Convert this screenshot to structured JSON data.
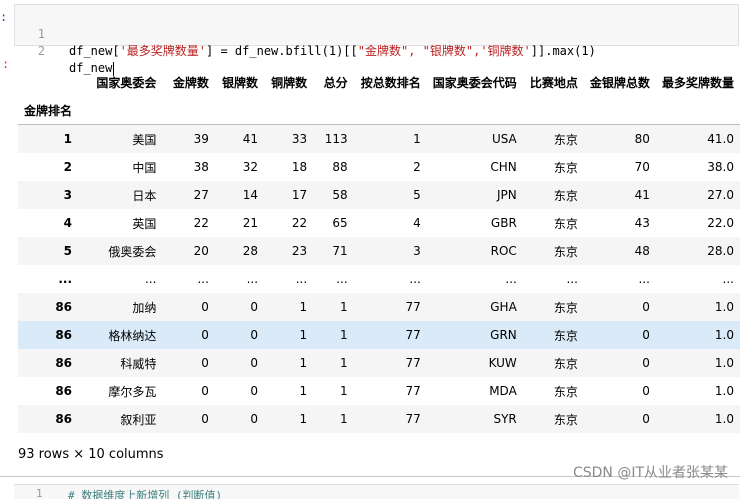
{
  "code_cell": {
    "prompt": ":",
    "line1": {
      "num": "1",
      "p1": "df_new[",
      "s1": "'最多奖牌数量'",
      "p2": "] = df_new.bfill(1)[[",
      "s2": "\"金牌数\", \"银牌数\",'铜牌数'",
      "p3": "]].max(1)"
    },
    "line2": {
      "num": "2",
      "text": "df_new"
    }
  },
  "output_prompt": ":",
  "dataframe": {
    "columns": [
      "国家奥委会",
      "金牌数",
      "银牌数",
      "铜牌数",
      "总分",
      "按总数排名",
      "国家奥委会代码",
      "比赛地点",
      "金银牌总数",
      "最多奖牌数量"
    ],
    "index_name": "金牌排名",
    "rows": [
      {
        "index": "1",
        "cells": [
          "美国",
          "39",
          "41",
          "33",
          "113",
          "1",
          "USA",
          "东京",
          "80",
          "41.0"
        ]
      },
      {
        "index": "2",
        "cells": [
          "中国",
          "38",
          "32",
          "18",
          "88",
          "2",
          "CHN",
          "东京",
          "70",
          "38.0"
        ]
      },
      {
        "index": "3",
        "cells": [
          "日本",
          "27",
          "14",
          "17",
          "58",
          "5",
          "JPN",
          "东京",
          "41",
          "27.0"
        ]
      },
      {
        "index": "4",
        "cells": [
          "英国",
          "22",
          "21",
          "22",
          "65",
          "4",
          "GBR",
          "东京",
          "43",
          "22.0"
        ]
      },
      {
        "index": "5",
        "cells": [
          "俄奥委会",
          "20",
          "28",
          "23",
          "71",
          "3",
          "ROC",
          "东京",
          "48",
          "28.0"
        ]
      },
      {
        "index": "...",
        "cells": [
          "...",
          "...",
          "...",
          "...",
          "...",
          "...",
          "...",
          "...",
          "...",
          "..."
        ]
      },
      {
        "index": "86",
        "cells": [
          "加纳",
          "0",
          "0",
          "1",
          "1",
          "77",
          "GHA",
          "东京",
          "0",
          "1.0"
        ]
      },
      {
        "index": "86",
        "cells": [
          "格林纳达",
          "0",
          "0",
          "1",
          "1",
          "77",
          "GRN",
          "东京",
          "0",
          "1.0"
        ]
      },
      {
        "index": "86",
        "cells": [
          "科威特",
          "0",
          "0",
          "1",
          "1",
          "77",
          "KUW",
          "东京",
          "0",
          "1.0"
        ]
      },
      {
        "index": "86",
        "cells": [
          "摩尔多瓦",
          "0",
          "0",
          "1",
          "1",
          "77",
          "MDA",
          "东京",
          "0",
          "1.0"
        ]
      },
      {
        "index": "86",
        "cells": [
          "叙利亚",
          "0",
          "0",
          "1",
          "1",
          "77",
          "SYR",
          "东京",
          "0",
          "1.0"
        ]
      }
    ],
    "highlighted_row": 7,
    "footer": "93 rows × 10 columns"
  },
  "next_cell": {
    "num": "1",
    "text": "# 数据维度上新增列 (判断值)"
  },
  "watermark": "CSDN @IT从业者张某某",
  "colors": {
    "code_bg": "#f7f7f7",
    "string": "#ba2121",
    "row_stripe": "#f5f5f5",
    "row_highlight": "#daeaf8"
  }
}
